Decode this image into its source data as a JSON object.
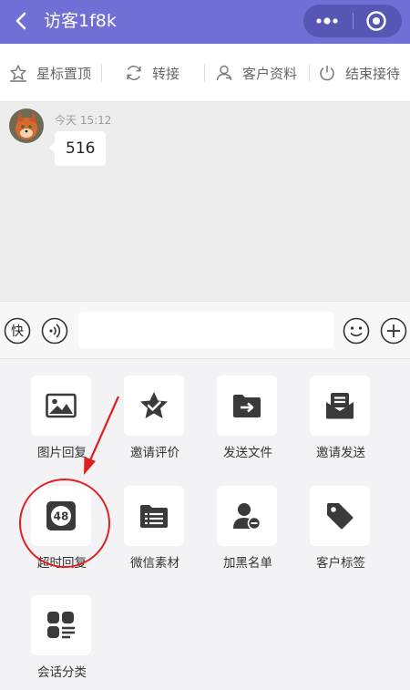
{
  "header": {
    "title": "访客1f8k",
    "background": "#6f6fd6"
  },
  "toolbar": {
    "items": [
      {
        "label": "星标置顶",
        "icon": "star-icon"
      },
      {
        "label": "转接",
        "icon": "refresh-icon"
      },
      {
        "label": "客户资料",
        "icon": "person-icon"
      },
      {
        "label": "结束接待",
        "icon": "power-icon"
      }
    ]
  },
  "chat": {
    "messages": [
      {
        "time": "今天 15:12",
        "text": "516"
      }
    ]
  },
  "input": {
    "quick_label": "快",
    "value": ""
  },
  "panel": {
    "items": [
      {
        "label": "图片回复",
        "icon": "image-icon"
      },
      {
        "label": "邀请评价",
        "icon": "star-badge-icon"
      },
      {
        "label": "发送文件",
        "icon": "folder-arrow-icon"
      },
      {
        "label": "邀请发送",
        "icon": "envelope-icon"
      },
      {
        "label": "超时回复",
        "icon": "clock-48-icon",
        "badge": "48"
      },
      {
        "label": "微信素材",
        "icon": "folder-list-icon"
      },
      {
        "label": "加黑名单",
        "icon": "user-block-icon"
      },
      {
        "label": "客户标签",
        "icon": "tag-icon"
      },
      {
        "label": "会话分类",
        "icon": "category-icon"
      }
    ]
  },
  "annotation": {
    "color": "#e02020",
    "highlighted_item": "超时回复"
  }
}
